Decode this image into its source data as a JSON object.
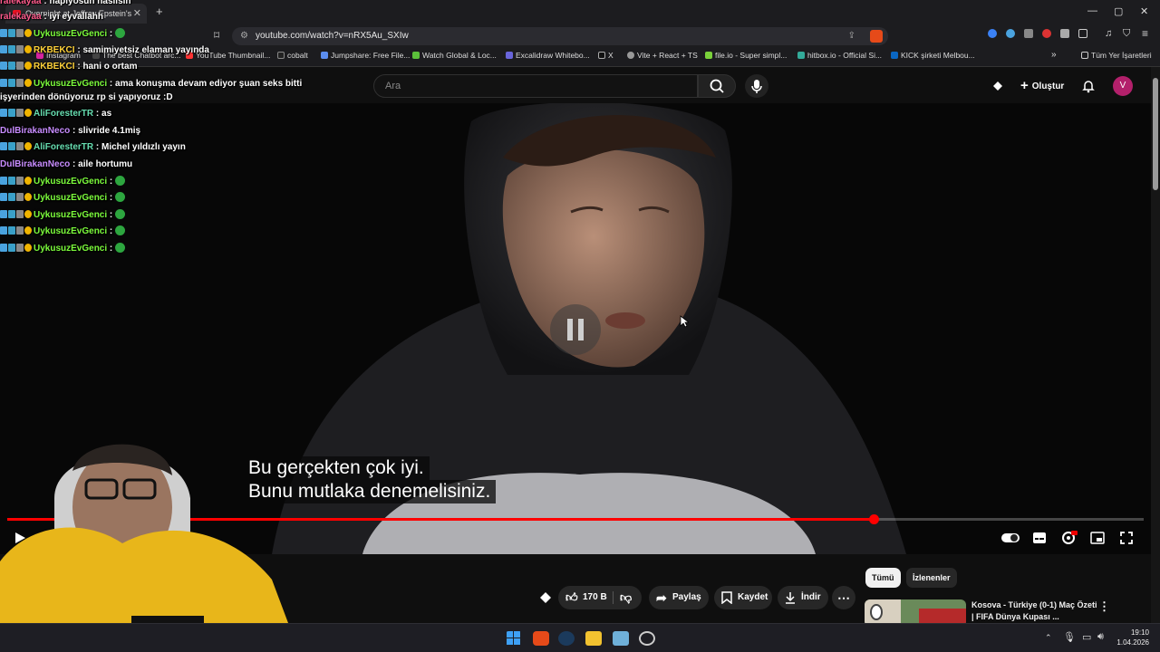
{
  "browser": {
    "tab_title": "Overnight at Jeffrey Epstein's",
    "url": "youtube.com/watch?v=nRX5Au_SXIw",
    "bookmarks": [
      "Instagram",
      "The best Chatbot arc...",
      "YouTube Thumbnail...",
      "cobalt",
      "Jumpshare: Free File...",
      "Watch Global & Loc...",
      "Excalidraw Whitebo...",
      "X",
      "Vite + React + TS",
      "file.io - Super simpl...",
      "hitbox.io - Official Si...",
      "KICK şirketi Melbou..."
    ],
    "all_bookmarks": "Tüm Yer İşaretleri"
  },
  "youtube": {
    "search_placeholder": "Ara",
    "create_label": "Oluştur",
    "avatar_letter": "V",
    "subtitle_lines": [
      "Bu gerçekten çok iyi.",
      "Bunu mutlaka denemelisiniz."
    ],
    "progress_fraction": 0.762,
    "like_count": "170 B",
    "share_label": "Paylaş",
    "save_label": "Kaydet",
    "download_label": "İndir",
    "chips": [
      "Tümü",
      "İzlenenler"
    ],
    "side_video_title": "Kosova - Türkiye (0-1) Maç Özeti | FIFA Dünya Kupası ..."
  },
  "chat": [
    {
      "user": "ralekayaa",
      "msg": ": napıyosun nasılsın",
      "color": "#ff5a8c"
    },
    {
      "user": "ralekayaa",
      "msg": ": iyi eyvallahh",
      "color": "#ff5a8c"
    },
    {
      "user": "UykusuzEvGenci",
      "msg": ":",
      "color": "#7cfc3c",
      "emote": true
    },
    {
      "user": "RKBEKCI",
      "msg": ": samimiyetsiz elaman yayında",
      "color": "#ffd23a"
    },
    {
      "user": "RKBEKCI",
      "msg": ": hani o ortam",
      "color": "#ffd23a"
    },
    {
      "user": "UykusuzEvGenci",
      "msg": ": ama konuşma devam ediyor şuan seks bitti",
      "color": "#7cfc3c"
    },
    {
      "user": "",
      "msg": "işyerinden dönüyoruz rp si yapıyoruz :D",
      "color": "#fff"
    },
    {
      "user": "AliForesterTR",
      "msg": ": as",
      "color": "#66ddb0"
    },
    {
      "user": "DulBirakanNeco",
      "msg": ": slivride 4.1miş",
      "color": "#c88cff"
    },
    {
      "user": "AliForesterTR",
      "msg": ": Michel yıldızlı yayın",
      "color": "#66ddb0"
    },
    {
      "user": "DulBirakanNeco",
      "msg": ": aile hortumu",
      "color": "#c88cff"
    },
    {
      "user": "UykusuzEvGenci",
      "msg": ":",
      "color": "#7cfc3c",
      "emote": true
    },
    {
      "user": "UykusuzEvGenci",
      "msg": ":",
      "color": "#7cfc3c",
      "emote": true
    },
    {
      "user": "UykusuzEvGenci",
      "msg": ":",
      "color": "#7cfc3c",
      "emote": true
    },
    {
      "user": "UykusuzEvGenci",
      "msg": ":",
      "color": "#7cfc3c",
      "emote": true
    },
    {
      "user": "UykusuzEvGenci",
      "msg": ":",
      "color": "#7cfc3c",
      "emote": true
    }
  ],
  "taskbar": {
    "time": "19:10",
    "date": "1.04.2026"
  }
}
